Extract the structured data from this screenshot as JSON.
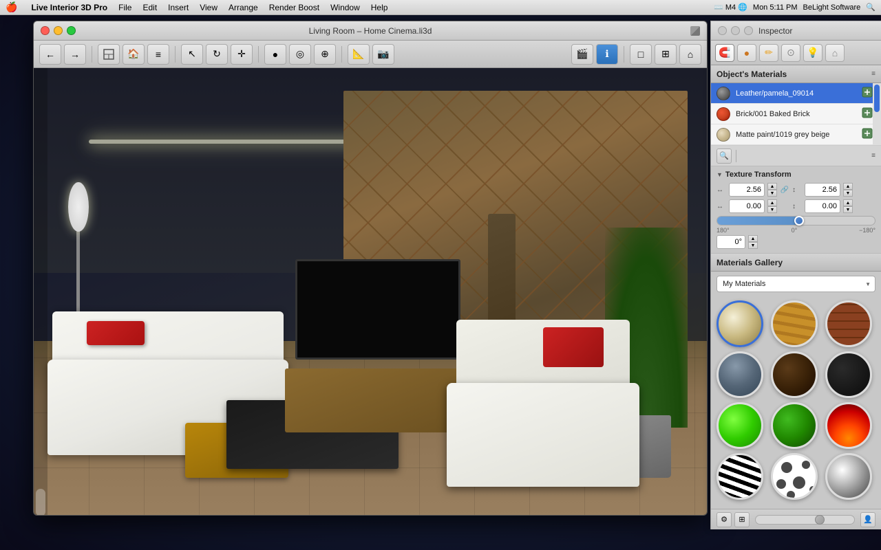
{
  "menubar": {
    "apple": "🍎",
    "items": [
      {
        "label": "Live Interior 3D Pro",
        "bold": true
      },
      {
        "label": "File"
      },
      {
        "label": "Edit"
      },
      {
        "label": "Insert"
      },
      {
        "label": "View"
      },
      {
        "label": "Arrange"
      },
      {
        "label": "Render Boost"
      },
      {
        "label": "Window"
      },
      {
        "label": "Help"
      }
    ],
    "right": {
      "time": "Mon 5:11 PM",
      "brand": "BeLight Software"
    }
  },
  "window": {
    "title": "Living Room – Home Cinema.li3d",
    "close_btn": "×",
    "min_btn": "–",
    "max_btn": "+"
  },
  "inspector": {
    "title": "Inspector",
    "sections": {
      "materials_title": "Object's Materials",
      "texture_title": "Texture Transform",
      "gallery_title": "Materials Gallery"
    },
    "materials": [
      {
        "name": "Leather/pamela_09014",
        "swatch_bg": "#6a6a6a"
      },
      {
        "name": "Brick/001 Baked Brick",
        "swatch_bg": "#cc4422"
      },
      {
        "name": "Matte paint/1019 grey beige",
        "swatch_bg": "#d4c8aa"
      }
    ],
    "texture": {
      "scale_x": "2.56",
      "scale_y": "2.56",
      "offset_x": "0.00",
      "offset_y": "0.00",
      "angle": "0°",
      "angle_left": "180°",
      "angle_center": "0°",
      "angle_right": "−180°",
      "slider_pct": 52
    },
    "gallery": {
      "dropdown_label": "My Materials",
      "items": [
        {
          "id": "beige",
          "class": "mat-beige"
        },
        {
          "id": "wood-light",
          "class": "mat-wood-light"
        },
        {
          "id": "brick",
          "class": "mat-brick"
        },
        {
          "id": "stone",
          "class": "mat-stone"
        },
        {
          "id": "dark-brown",
          "class": "mat-dark-brown"
        },
        {
          "id": "very-dark",
          "class": "mat-very-dark"
        },
        {
          "id": "green-bright",
          "class": "mat-green-bright"
        },
        {
          "id": "green-dark",
          "class": "mat-green-dark"
        },
        {
          "id": "fire",
          "class": "mat-fire"
        },
        {
          "id": "zebra",
          "class": "mat-zebra"
        },
        {
          "id": "spots",
          "class": "mat-spots"
        },
        {
          "id": "silver",
          "class": "mat-silver"
        }
      ]
    }
  },
  "toolbar": {
    "title": "Living Room – Home Cinema.li3d"
  }
}
